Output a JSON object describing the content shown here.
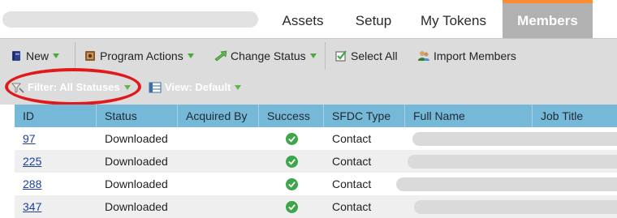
{
  "tabs": {
    "assets": "Assets",
    "setup": "Setup",
    "my_tokens": "My Tokens",
    "members": "Members"
  },
  "toolbar": {
    "new": "New",
    "program_actions": "Program Actions",
    "change_status": "Change Status",
    "select_all": "Select All",
    "import_members": "Import Members"
  },
  "filters": {
    "filter_label": "Filter: All Statuses",
    "view_label": "View: Default"
  },
  "table": {
    "columns": [
      "ID",
      "Status",
      "Acquired By",
      "Success",
      "SFDC Type",
      "Full Name",
      "Job Title"
    ],
    "rows": [
      {
        "id": "97",
        "status": "Downloaded",
        "acquired_by": "",
        "success": true,
        "sfdc_type": "Contact"
      },
      {
        "id": "225",
        "status": "Downloaded",
        "acquired_by": "",
        "success": true,
        "sfdc_type": "Contact"
      },
      {
        "id": "288",
        "status": "Downloaded",
        "acquired_by": "",
        "success": true,
        "sfdc_type": "Contact"
      },
      {
        "id": "347",
        "status": "Downloaded",
        "acquired_by": "",
        "success": true,
        "sfdc_type": "Contact"
      }
    ]
  },
  "colors": {
    "active_tab": "#b1b1b1",
    "active_tab_accent": "#ff8c2e",
    "toolbar_bg": "#dcdcdc",
    "grid_header": "#76b8d8",
    "success_green": "#3ea64a",
    "link": "#1e3f9e",
    "highlight": "#e01a1a"
  },
  "icons": {
    "new": "book-icon",
    "program_actions": "program-actions-icon",
    "change_status": "change-status-arrow-icon",
    "select_all": "select-all-icon",
    "import_members": "import-members-icon",
    "filter": "funnel-icon",
    "view": "view-grid-icon",
    "success": "checkmark-icon"
  }
}
